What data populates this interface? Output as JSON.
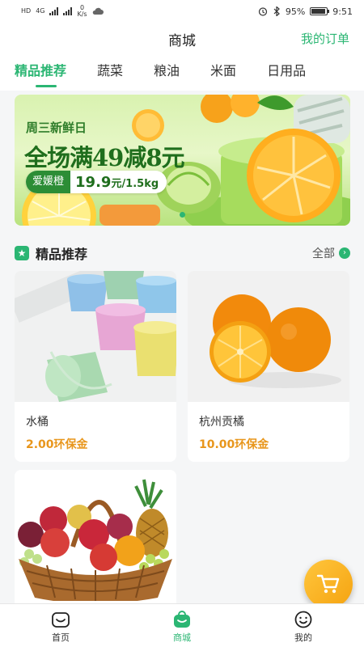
{
  "status_bar": {
    "network_left": "HD",
    "speed_value": "0",
    "speed_unit": "K/s",
    "battery": "95%",
    "time": "9:51",
    "signal_label": "4G"
  },
  "header": {
    "title": "商城",
    "orders_link": "我的订单"
  },
  "tabs": [
    {
      "label": "精品推荐",
      "active": true
    },
    {
      "label": "蔬菜",
      "active": false
    },
    {
      "label": "粮油",
      "active": false
    },
    {
      "label": "米面",
      "active": false
    },
    {
      "label": "日用品",
      "active": false
    }
  ],
  "banner": {
    "date_text": "周三新鲜日",
    "headline": "全场满49减8元",
    "tag_left": "爱媛橙",
    "tag_price": "19.9",
    "tag_unit": "元/1.5kg",
    "page_count": 1
  },
  "section": {
    "title": "精品推荐",
    "more": "全部"
  },
  "products": [
    {
      "name": "水桶",
      "price": "2.00环保金"
    },
    {
      "name": "杭州贡橘",
      "price": "10.00环保金"
    },
    {
      "name": "",
      "price": ""
    }
  ],
  "bottom_nav": [
    {
      "label": "首页",
      "icon": "home-icon",
      "active": false
    },
    {
      "label": "商城",
      "icon": "shop-bag-icon",
      "active": true
    },
    {
      "label": "我的",
      "icon": "profile-icon",
      "active": false
    }
  ],
  "colors": {
    "accent": "#2bb673",
    "price": "#e8961c",
    "fab": "#f5a310"
  }
}
